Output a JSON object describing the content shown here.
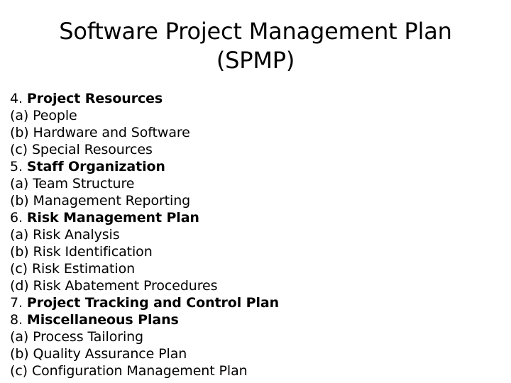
{
  "slide": {
    "title": "Software Project Management Plan\n(SPMP)",
    "title_line_1": "Software Project Management Plan",
    "title_line_2": "(SPMP)",
    "background_color": "#ffffff",
    "text_color": "#000000",
    "outline": [
      {
        "marker": "4.",
        "text": "Project Resources",
        "level": "heading"
      },
      {
        "marker": "(a)",
        "text": "People",
        "level": "sub"
      },
      {
        "marker": "(b)",
        "text": "Hardware and Software",
        "level": "sub"
      },
      {
        "marker": "(c)",
        "text": "Special Resources",
        "level": "sub"
      },
      {
        "marker": "5.",
        "text": "Staff Organization",
        "level": "heading"
      },
      {
        "marker": "(a)",
        "text": "Team Structure",
        "level": "sub"
      },
      {
        "marker": "(b)",
        "text": "Management Reporting",
        "level": "sub"
      },
      {
        "marker": "6.",
        "text": "Risk Management Plan",
        "level": "heading"
      },
      {
        "marker": "(a)",
        "text": "Risk Analysis",
        "level": "sub"
      },
      {
        "marker": "(b)",
        "text": "Risk Identification",
        "level": "sub"
      },
      {
        "marker": "(c)",
        "text": "Risk Estimation",
        "level": "sub"
      },
      {
        "marker": "(d)",
        "text": "Risk Abatement Procedures",
        "level": "sub"
      },
      {
        "marker": "7.",
        "text": "Project Tracking and Control Plan",
        "level": "heading"
      },
      {
        "marker": "8.",
        "text": "Miscellaneous Plans",
        "level": "heading"
      },
      {
        "marker": "(a)",
        "text": "Process Tailoring",
        "level": "sub"
      },
      {
        "marker": "(b)",
        "text": "Quality Assurance Plan",
        "level": "sub"
      },
      {
        "marker": "(c)",
        "text": "Configuration Management Plan",
        "level": "sub"
      }
    ]
  }
}
